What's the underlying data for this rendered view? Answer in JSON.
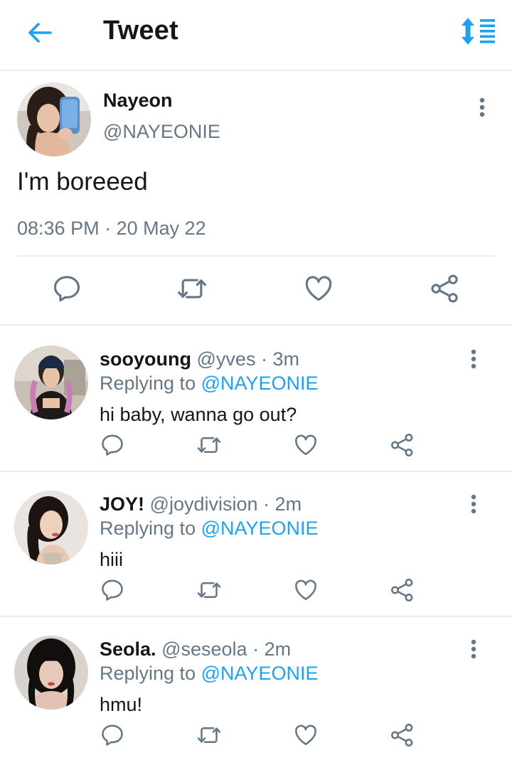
{
  "header": {
    "title": "Tweet",
    "back_icon": "arrow-left-icon",
    "sort_icon": "sort-list-icon",
    "accent_color": "#1da1f2"
  },
  "main_tweet": {
    "name": "Nayeon",
    "handle": "@NAYEONIE",
    "text": "I'm boreeed",
    "time": "08:36 PM",
    "separator": "·",
    "date": "20 May 22"
  },
  "replies": [
    {
      "name": "sooyoung",
      "handle": "@yves",
      "separator": "·",
      "time": "3m",
      "replying_prefix": "Replying to",
      "replying_to": "@NAYEONIE",
      "text": "hi baby, wanna go out?"
    },
    {
      "name": "JOY!",
      "handle": "@joydivision",
      "separator": "·",
      "time": "2m",
      "replying_prefix": "Replying to",
      "replying_to": "@NAYEONIE",
      "text": "hiii"
    },
    {
      "name": "Seola.",
      "handle": "@seseola",
      "separator": "·",
      "time": "2m",
      "replying_prefix": "Replying to",
      "replying_to": "@NAYEONIE",
      "text": "hmu!"
    }
  ],
  "colors": {
    "text_primary": "#14171a",
    "text_secondary": "#657786",
    "mention": "#1da1f2",
    "divider": "#e6ecf0"
  }
}
